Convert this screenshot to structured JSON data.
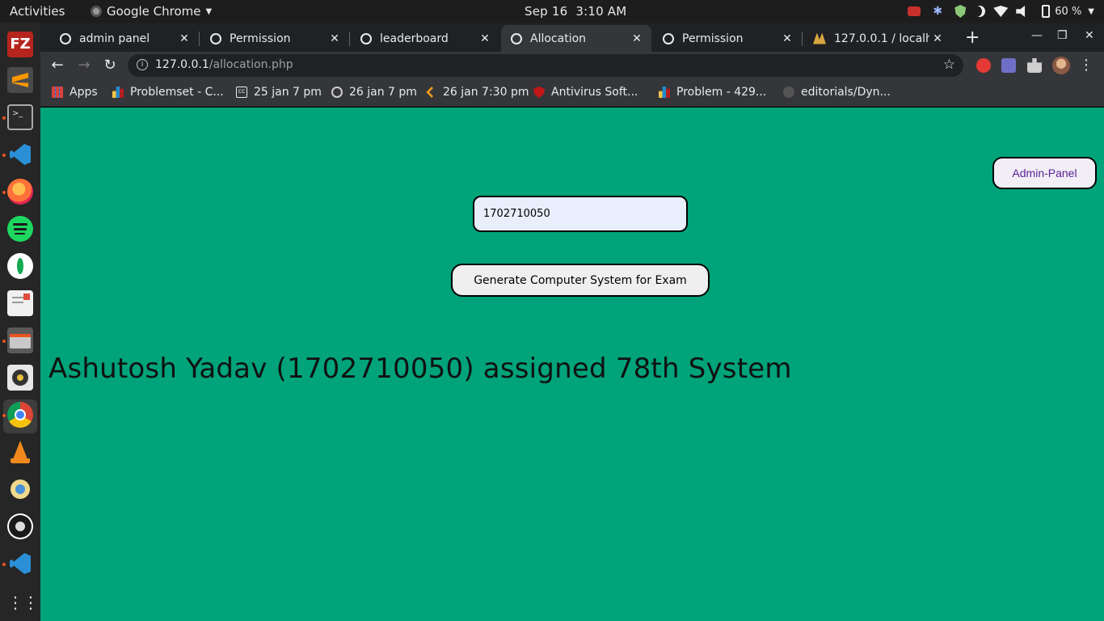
{
  "system_bar": {
    "activities": "Activities",
    "app_name": "Google Chrome",
    "date": "Sep 16",
    "time": "3:10 AM",
    "battery": "60 %"
  },
  "browser": {
    "tabs": [
      {
        "label": "admin panel"
      },
      {
        "label": "Permission"
      },
      {
        "label": "leaderboard"
      },
      {
        "label": "Allocation"
      },
      {
        "label": "Permission"
      },
      {
        "label": "127.0.0.1 / localho"
      }
    ],
    "active_tab": 3,
    "url_host": "127.0.0.1",
    "url_path": "/allocation.php",
    "bookmarks": [
      {
        "label": "Apps"
      },
      {
        "label": "Problemset - C..."
      },
      {
        "label": "25 jan 7 pm"
      },
      {
        "label": "26 jan 7 pm"
      },
      {
        "label": "26 jan 7:30 pm"
      },
      {
        "label": "Antivirus Soft..."
      },
      {
        "label": "Problem - 429..."
      },
      {
        "label": "editorials/Dyn..."
      }
    ]
  },
  "page": {
    "admin_button": "Admin-Panel",
    "roll_input_value": "1702710050",
    "generate_button": "Generate Computer System for Exam",
    "result_text": "Ashutosh Yadav (1702710050) assigned 78th System"
  },
  "colors": {
    "page_bg": "#00a37a",
    "admin_text": "#5b1f96"
  }
}
